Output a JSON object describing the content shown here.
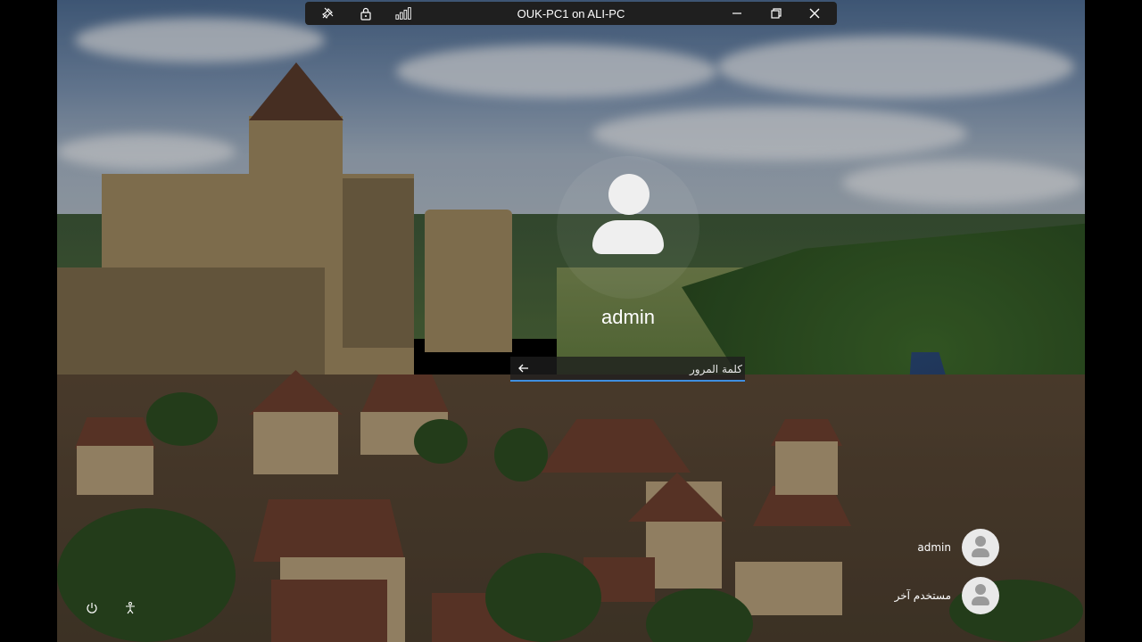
{
  "rdp_bar": {
    "title": "OUK-PC1 on ALI-PC",
    "icons": [
      "pin-icon",
      "lock-icon",
      "signal-icon",
      "minimize-icon",
      "restore-icon",
      "close-icon"
    ]
  },
  "login": {
    "username": "admin",
    "password_placeholder": "كلمة المرور",
    "submit_icon": "arrow-left-icon"
  },
  "user_list": [
    {
      "label": "admin"
    },
    {
      "label": "مستخدم آخر"
    }
  ],
  "bottom_icons": [
    "power-icon",
    "accessibility-icon"
  ],
  "colors": {
    "accent": "#3f8ee0",
    "rdp_bar_bg": "#1f1f1f"
  }
}
